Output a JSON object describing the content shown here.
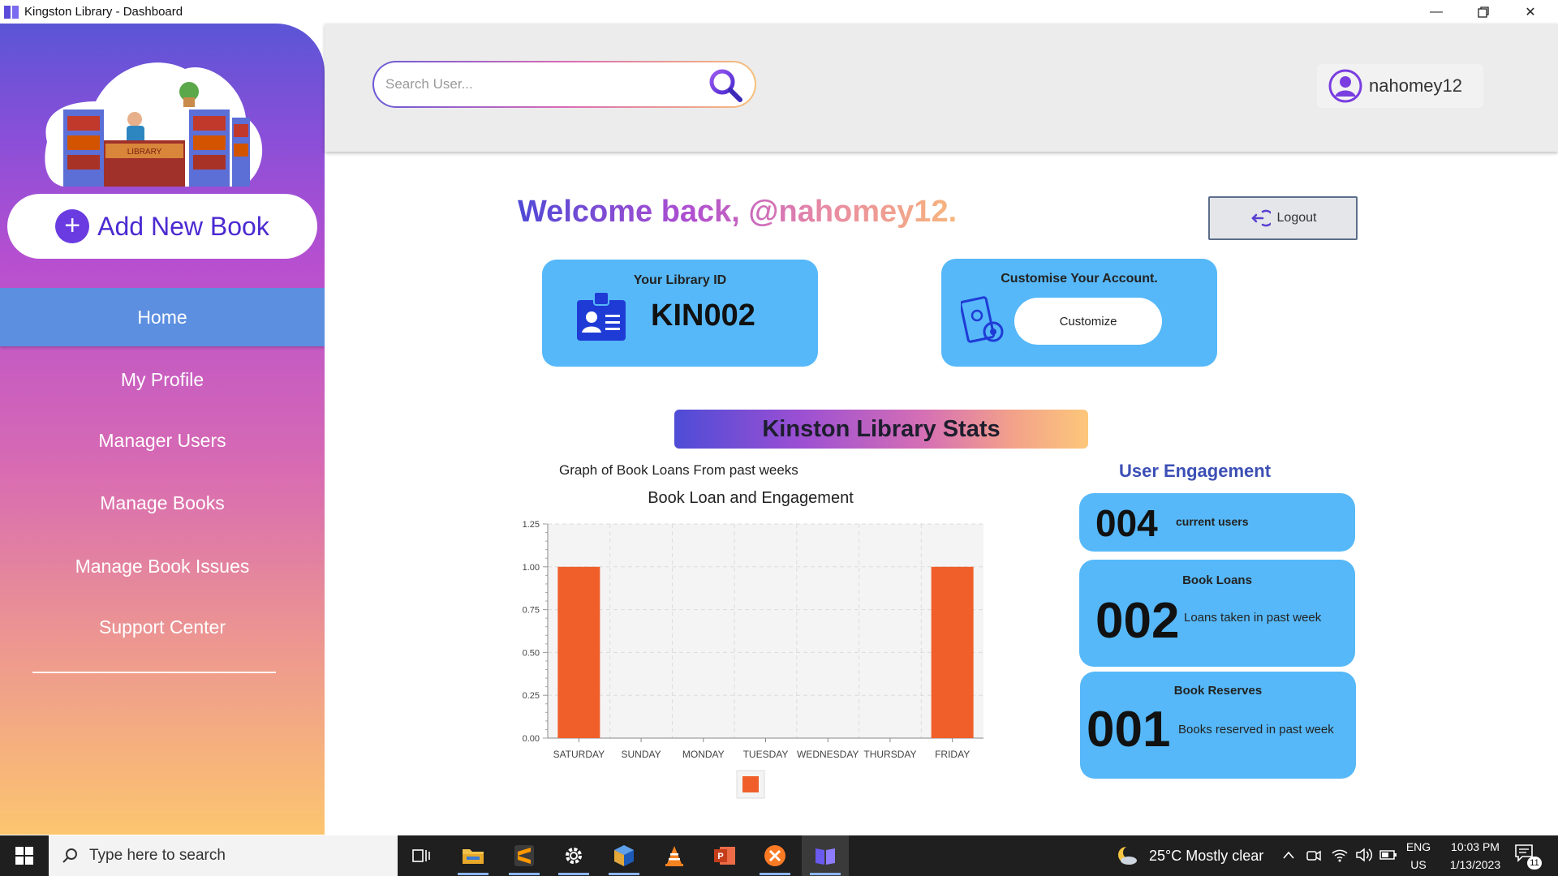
{
  "window": {
    "title": "Kingston Library -  Dashboard",
    "controls": [
      "minimize-icon",
      "restore-icon",
      "close-icon"
    ]
  },
  "sidebar": {
    "logo_sign": "LIBRARY",
    "add_book_label": "Add New Book",
    "items": [
      {
        "label": "Home",
        "active": true
      },
      {
        "label": "My Profile"
      },
      {
        "label": "Manager Users"
      },
      {
        "label": "Manage Books"
      },
      {
        "label": "Manage Book Issues"
      },
      {
        "label": "Support Center"
      }
    ]
  },
  "header": {
    "search_placeholder": "Search User...",
    "username": "nahomey12"
  },
  "main": {
    "welcome": "Welcome back, @nahomey12.",
    "logout_label": "Logout",
    "library_id_card": {
      "heading": "Your Library ID",
      "value": "KIN002"
    },
    "customize_card": {
      "heading": "Customise Your Account.",
      "button": "Customize"
    },
    "stats_banner": "Kinston Library Stats",
    "graph_caption": "Graph of Book Loans From past weeks"
  },
  "chart_data": {
    "type": "bar",
    "title": "Book Loan and Engagement",
    "categories": [
      "SATURDAY",
      "SUNDAY",
      "MONDAY",
      "TUESDAY",
      "WEDNESDAY",
      "THURSDAY",
      "FRIDAY"
    ],
    "values": [
      1,
      0,
      0,
      0,
      0,
      0,
      1
    ],
    "yticks": [
      "0.00",
      "0.25",
      "0.50",
      "0.75",
      "1.00",
      "1.25"
    ],
    "ylim": [
      0,
      1.25
    ],
    "grid": true,
    "bar_color": "#f05f2a",
    "legend": "bottom-center"
  },
  "engagement": {
    "title": "User Engagement",
    "current_users": {
      "value": "004",
      "label": "current users"
    },
    "book_loans": {
      "heading": "Book Loans",
      "value": "002",
      "label": "Loans taken in past week"
    },
    "book_reserves": {
      "heading": "Book Reserves",
      "value": "001",
      "label": "Books reserved in past week"
    }
  },
  "taskbar": {
    "search_placeholder": "Type here to search",
    "weather": "25°C  Mostly clear",
    "language": "ENG",
    "region": "US",
    "time": "10:03 PM",
    "date": "1/13/2023",
    "notification_count": "11"
  },
  "colors": {
    "card_blue": "#56b8f8",
    "accent_purple": "#6a3be0",
    "bar_orange": "#f05f2a"
  }
}
